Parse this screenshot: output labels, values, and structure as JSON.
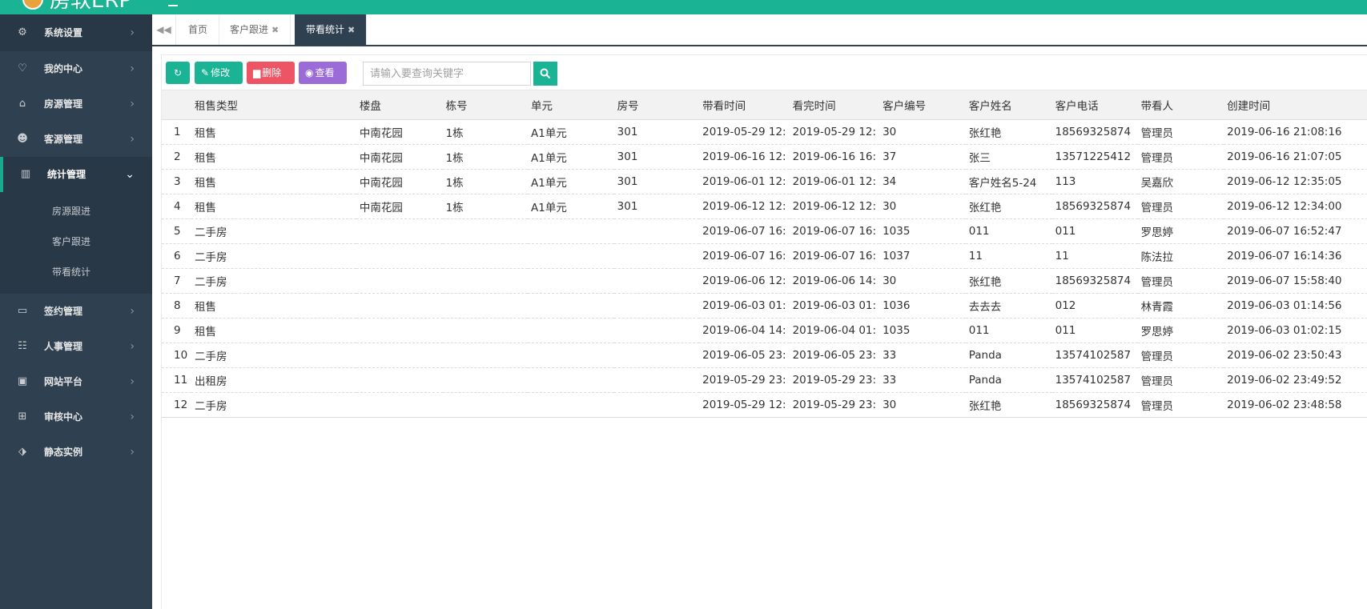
{
  "app": {
    "title": "房软ERP"
  },
  "sidebar": {
    "items": [
      {
        "label": "系统设置",
        "icon": "gears-icon",
        "glyph": "⚙"
      },
      {
        "label": "我的中心",
        "icon": "heart-icon",
        "glyph": "♡"
      },
      {
        "label": "房源管理",
        "icon": "home-icon",
        "glyph": "⌂"
      },
      {
        "label": "客源管理",
        "icon": "users-icon",
        "glyph": "☻"
      },
      {
        "label": "统计管理",
        "icon": "bar-chart-icon",
        "glyph": "▥"
      },
      {
        "label": "签约管理",
        "icon": "credit-card-icon",
        "glyph": "▭"
      },
      {
        "label": "人事管理",
        "icon": "sitemap-icon",
        "glyph": "☷"
      },
      {
        "label": "网站平台",
        "icon": "desktop-icon",
        "glyph": "▣"
      },
      {
        "label": "审核中心",
        "icon": "gift-icon",
        "glyph": "⊞"
      },
      {
        "label": "静态实例",
        "icon": "tags-icon",
        "glyph": "⬗"
      }
    ],
    "sub_items": [
      "房源跟进",
      "客户跟进",
      "带看统计"
    ]
  },
  "tabs": [
    {
      "label": "首页"
    },
    {
      "label": "客户跟进"
    },
    {
      "label": "带看统计"
    }
  ],
  "toolbar": {
    "edit_label": "修改",
    "delete_label": "删除",
    "view_label": "查看"
  },
  "search": {
    "placeholder": "请输入要查询关键字"
  },
  "table": {
    "columns": [
      "租售类型",
      "楼盘",
      "栋号",
      "单元",
      "房号",
      "带看时间",
      "看完时间",
      "客户编号",
      "客户姓名",
      "客户电话",
      "带看人",
      "创建时间"
    ],
    "rows": [
      [
        "1",
        "租售",
        "中南花园",
        "1栋",
        "A1单元",
        "301",
        "2019-05-29 12:",
        "2019-05-29 12:",
        "30",
        "张红艳",
        "18569325874",
        "管理员",
        "2019-06-16 21:08:16"
      ],
      [
        "2",
        "租售",
        "中南花园",
        "1栋",
        "A1单元",
        "301",
        "2019-06-16 12:",
        "2019-06-16 16:",
        "37",
        "张三",
        "13571225412",
        "管理员",
        "2019-06-16 21:07:05"
      ],
      [
        "3",
        "租售",
        "中南花园",
        "1栋",
        "A1单元",
        "301",
        "2019-06-01 12:",
        "2019-06-01 12:",
        "34",
        " 客户姓名5-24",
        "113",
        "吴嘉欣",
        "2019-06-12 12:35:05"
      ],
      [
        "4",
        "租售",
        "中南花园",
        "1栋",
        "A1单元",
        "301",
        "2019-06-12 12:",
        "2019-06-12 12:",
        "30",
        "张红艳",
        "18569325874",
        "管理员",
        "2019-06-12 12:34:00"
      ],
      [
        "5",
        "二手房",
        "",
        "",
        "",
        "",
        "2019-06-07 16:",
        "2019-06-07 16:",
        "1035",
        "011",
        "011",
        "罗思婷",
        "2019-06-07 16:52:47"
      ],
      [
        "6",
        "二手房",
        "",
        "",
        "",
        "",
        "2019-06-07 16:",
        "2019-06-07 16:",
        "1037",
        "11",
        "11",
        "陈法拉",
        "2019-06-07 16:14:36"
      ],
      [
        "7",
        "二手房",
        "",
        "",
        "",
        "",
        "2019-06-06 12:",
        "2019-06-06 14:",
        "30",
        "张红艳",
        "18569325874",
        "管理员",
        "2019-06-07 15:58:40"
      ],
      [
        "8",
        "租售",
        "",
        "",
        "",
        "",
        "2019-06-03 01:",
        "2019-06-03 01:",
        "1036",
        "去去去",
        "012",
        "林青霞",
        "2019-06-03 01:14:56"
      ],
      [
        "9",
        "租售",
        "",
        "",
        "",
        "",
        "2019-06-04 14:",
        "2019-06-04 01:",
        "1035",
        "011",
        "011",
        "罗思婷",
        "2019-06-03 01:02:15"
      ],
      [
        "10",
        "二手房",
        "",
        "",
        "",
        "",
        "2019-06-05 23:",
        "2019-06-05 23:",
        "33",
        "Panda",
        "13574102587",
        "管理员",
        "2019-06-02 23:50:43"
      ],
      [
        "11",
        "出租房",
        "",
        "",
        "",
        "",
        "2019-05-29 23:",
        "2019-05-29 23:",
        "33",
        "Panda",
        "13574102587",
        "管理员",
        "2019-06-02 23:49:52"
      ],
      [
        "12",
        "二手房",
        "",
        "",
        "",
        "",
        "2019-05-29 12:",
        "2019-05-29 23:",
        "30",
        "张红艳",
        "18569325874",
        "管理员",
        "2019-06-02 23:48:58"
      ]
    ]
  },
  "colors": {
    "accent": "#1ab394",
    "sidebar_bg": "#2f4050",
    "danger": "#ed5565",
    "purple": "#9b6bd8"
  }
}
